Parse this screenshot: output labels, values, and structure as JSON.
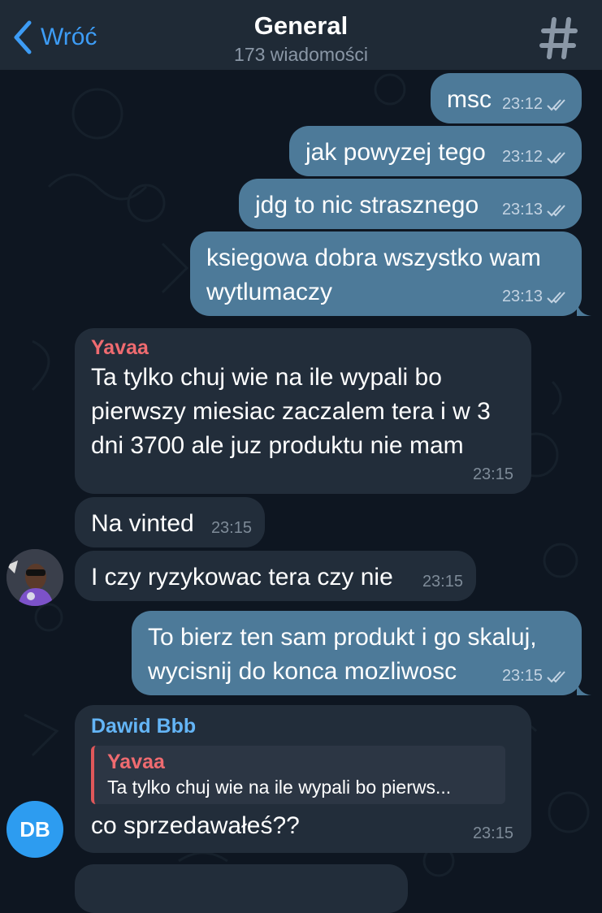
{
  "header": {
    "back_label": "Wróć",
    "title": "General",
    "subtitle": "173 wiadomości"
  },
  "messages": [
    {
      "text": "msc",
      "time": "23:12"
    },
    {
      "text": "jak powyzej tego",
      "time": "23:12"
    },
    {
      "text": "jdg to nic strasznego",
      "time": "23:13"
    },
    {
      "lines": [
        "ksiegowa dobra wszystko wam",
        "wytlumaczy"
      ],
      "time": "23:13"
    },
    {
      "sender": "Yavaa",
      "lines": [
        "Ta tylko chuj wie na ile wypali bo",
        "pierwszy miesiac zaczalem tera i w 3",
        "dni 3700 ale juz produktu nie mam"
      ],
      "time": "23:15"
    },
    {
      "text": "Na vinted",
      "time": "23:15"
    },
    {
      "text": "I czy ryzykowac tera czy nie",
      "time": "23:15"
    },
    {
      "lines": [
        "To bierz ten sam produkt i go skaluj,",
        "wycisnij do konca mozliwosc"
      ],
      "time": "23:15"
    },
    {
      "sender": "Dawid Bbb",
      "reply": {
        "name": "Yavaa",
        "text": "Ta tylko chuj wie na ile wypali bo pierws..."
      },
      "text": "co sprzedawałeś??",
      "time": "23:15"
    }
  ],
  "avatars": {
    "db_initials": "DB"
  },
  "colors": {
    "background": "#0e1621",
    "header": "#1f2a36",
    "outgoing_bubble": "#4d7a99",
    "incoming_bubble": "#222d3a",
    "accent": "#3d9cf5",
    "sender_yavaa": "#ef6b70",
    "sender_dawid": "#64b5f6"
  }
}
